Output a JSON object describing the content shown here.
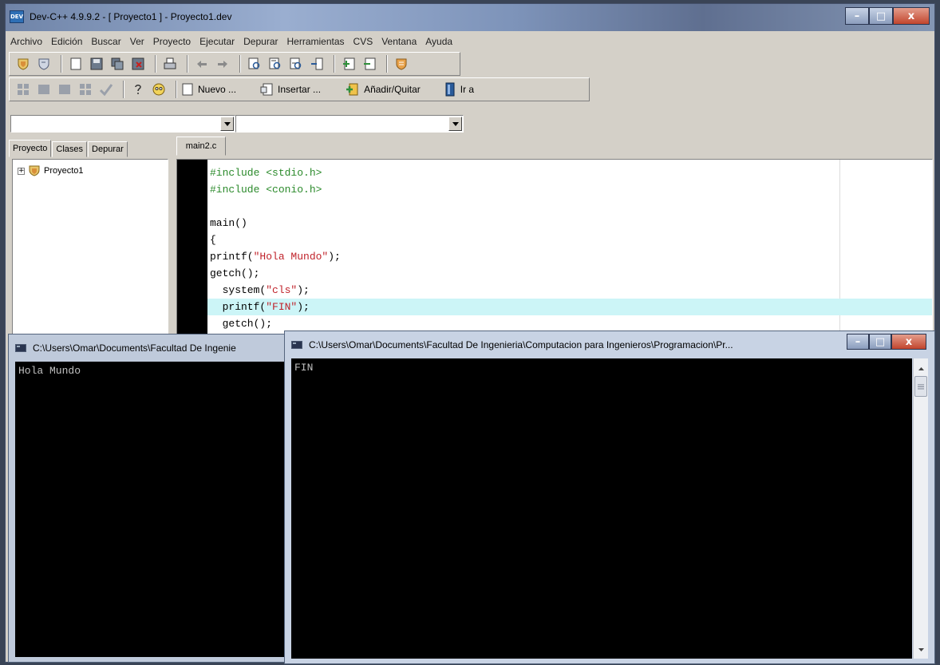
{
  "ide": {
    "title": "Dev-C++ 4.9.9.2  - [ Proyecto1 ] - Proyecto1.dev",
    "app_icon_text": "DEV",
    "caption": {
      "minimize": "–",
      "maximize": "□",
      "close": "x"
    }
  },
  "menu": [
    "Archivo",
    "Edición",
    "Buscar",
    "Ver",
    "Proyecto",
    "Ejecutar",
    "Depurar",
    "Herramientas",
    "CVS",
    "Ventana",
    "Ayuda"
  ],
  "toolbar2": {
    "new_label": "Nuevo ...",
    "insert_label": "Insertar ...",
    "add_remove_label": "Añadir/Quitar",
    "goto_label": "Ir a"
  },
  "combos": {
    "class_value": "",
    "member_value": ""
  },
  "left_panel": {
    "tabs": [
      "Proyecto",
      "Clases",
      "Depurar"
    ],
    "tree_root": "Proyecto1",
    "expander": "+"
  },
  "editor": {
    "tab": "main2.c",
    "lines": {
      "l1": "#include <stdio.h>",
      "l2": "#include <conio.h>",
      "l4": "main()",
      "l5": "{",
      "l6a": "printf(",
      "l6b": "\"Hola Mundo\"",
      "l6c": ");",
      "l7": "getch();",
      "l8a": "  system(",
      "l8b": "\"cls\"",
      "l8c": ");",
      "l9a": "  printf(",
      "l9b": "\"FIN\"",
      "l9c": ");",
      "l10": "  getch();"
    }
  },
  "console1": {
    "title": "C:\\Users\\Omar\\Documents\\Facultad De Ingenie",
    "output": "Hola Mundo"
  },
  "console2": {
    "title": "C:\\Users\\Omar\\Documents\\Facultad De Ingenieria\\Computacion para Ingenieros\\Programacion\\Pr...",
    "output": "FIN",
    "caption": {
      "minimize": "–",
      "maximize": "□",
      "close": "x"
    }
  },
  "colors": {
    "preprocessor": "#2b8a2b",
    "string": "#c0232b",
    "highlight_line": "#ccf5f7"
  }
}
